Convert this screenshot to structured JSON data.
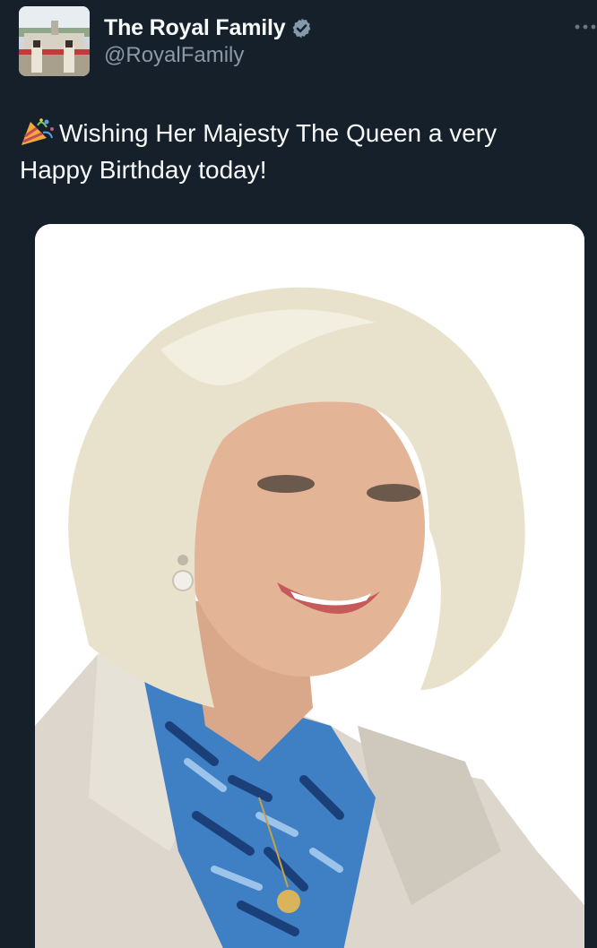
{
  "account": {
    "display_name": "The Royal Family",
    "handle": "@RoyalFamily",
    "verified_icon": "verified-badge-icon",
    "verified_color": "#829aab"
  },
  "menu": {
    "icon": "more-options-icon"
  },
  "tweet": {
    "emoji_icon": "party-popper-icon",
    "text_line1": "Wishing Her Majesty The Queen a very",
    "text_line2": "Happy Birthday today!"
  },
  "media": {
    "type": "photo"
  },
  "colors": {
    "background": "#15202b",
    "primary_text": "#f7f9f9",
    "secondary_text": "#8b98a5"
  }
}
